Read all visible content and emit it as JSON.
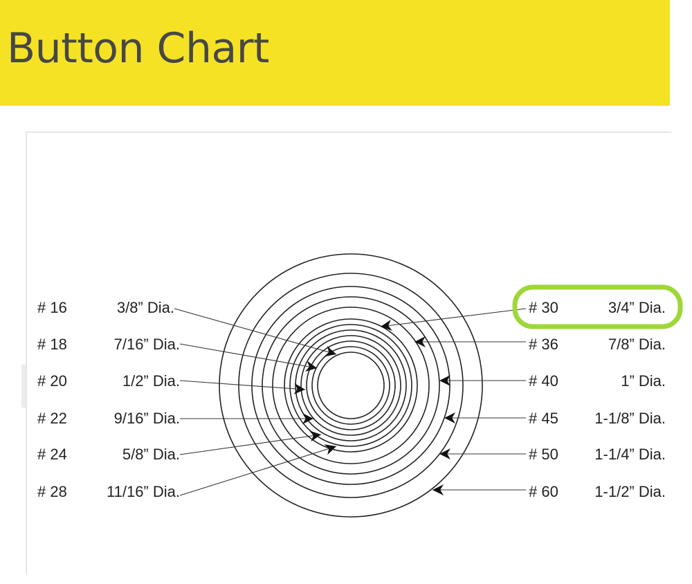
{
  "header": {
    "title": "Button Chart",
    "background": "#f6e225"
  },
  "diagram": {
    "left_labels": [
      {
        "num": "# 16",
        "dia": "3/8” Dia."
      },
      {
        "num": "# 18",
        "dia": "7/16” Dia."
      },
      {
        "num": "# 20",
        "dia": "1/2” Dia."
      },
      {
        "num": "# 22",
        "dia": "9/16” Dia."
      },
      {
        "num": "# 24",
        "dia": "5/8” Dia."
      },
      {
        "num": "# 28",
        "dia": "11/16” Dia."
      }
    ],
    "right_labels": [
      {
        "num": "# 30",
        "dia": "3/4” Dia.",
        "highlighted": true
      },
      {
        "num": "# 36",
        "dia": "7/8” Dia."
      },
      {
        "num": "# 40",
        "dia": "1” Dia."
      },
      {
        "num": "# 45",
        "dia": "1-1/8” Dia."
      },
      {
        "num": "# 50",
        "dia": "1-1/4” Dia."
      },
      {
        "num": "# 60",
        "dia": "1-1/2” Dia."
      }
    ],
    "highlight_color": "#9fd63a"
  }
}
